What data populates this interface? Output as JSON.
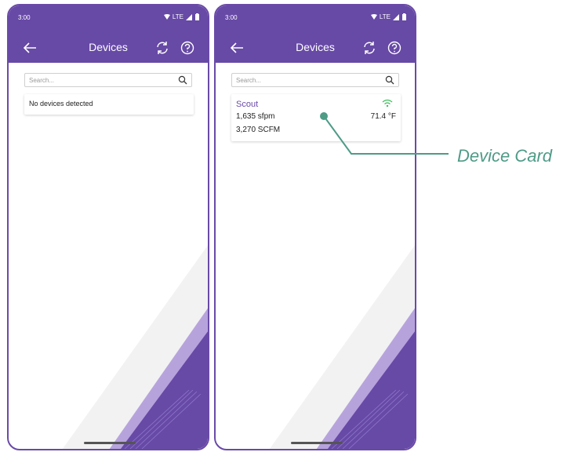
{
  "left_screen": {
    "status": {
      "time": "3:00",
      "network": "LTE"
    },
    "appbar": {
      "title": "Devices"
    },
    "search": {
      "placeholder": "Search..."
    },
    "empty_message": "No devices detected"
  },
  "right_screen": {
    "status": {
      "time": "3:00",
      "network": "LTE"
    },
    "appbar": {
      "title": "Devices"
    },
    "search": {
      "placeholder": "Search..."
    },
    "device": {
      "name": "Scout",
      "velocity": "1,635 sfpm",
      "flow": "3,270 SCFM",
      "temperature": "71.4 °F"
    }
  },
  "callout": {
    "label": "Device Card"
  },
  "colors": {
    "brand_purple": "#6749a6",
    "callout_teal": "#4e9b86",
    "wifi_green": "#3bbf5a",
    "stripe_light": "#f2f2f2",
    "stripe_lavender": "#b7a3dc"
  },
  "icons": {
    "back": "arrow-left-icon",
    "refresh": "refresh-icon",
    "help": "help-circle-icon",
    "search": "search-icon",
    "signal": "wifi-icon"
  }
}
